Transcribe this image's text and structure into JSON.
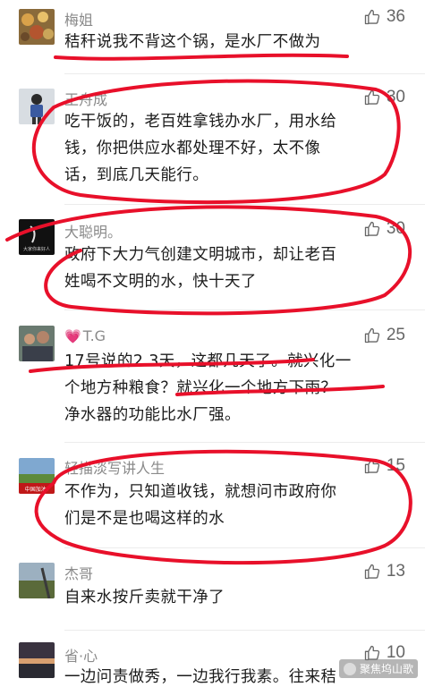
{
  "comments": [
    {
      "username": "梅姐",
      "likes": "36",
      "lines": [
        "秸秆说我不背这个锅，是水厂不做为"
      ]
    },
    {
      "username": "王舟成",
      "likes": "30",
      "lines": [
        "吃干饭的，老百姓拿钱办水厂，用水给",
        "钱，你把供应水都处理不好，太不像",
        "话，到底几天能行。"
      ]
    },
    {
      "username": "大聪明。",
      "likes": "30",
      "lines": [
        "政府下大力气创建文明城市，却让老百",
        "姓喝不文明的水，快十天了"
      ]
    },
    {
      "username": "T.G",
      "likes": "25",
      "lines": [
        "17号说的2 3天，这都几天了。就兴化一",
        "个地方种粮食？就兴化一个地方下雨？",
        "净水器的功能比水厂强。"
      ]
    },
    {
      "username": "轻描淡写讲人生",
      "likes": "15",
      "lines": [
        "不作为，只知道收钱，就想问市政府你",
        "们是不是也喝这样的水"
      ]
    },
    {
      "username": "杰哥",
      "likes": "13",
      "lines": [
        "自来水按斤卖就干净了"
      ]
    },
    {
      "username": "省·心",
      "likes": "10",
      "lines": [
        "一边问责做秀，一边我行我素。往来秸"
      ]
    }
  ],
  "avatar_texts": {
    "dacongming": "大家你来好人",
    "qingmiao": "中国加油!"
  },
  "watermark": "聚焦坞山歌",
  "colors": {
    "annotation_red": "#e8102a",
    "username_gray": "#8a8a8a",
    "text": "#1c1c1c"
  }
}
